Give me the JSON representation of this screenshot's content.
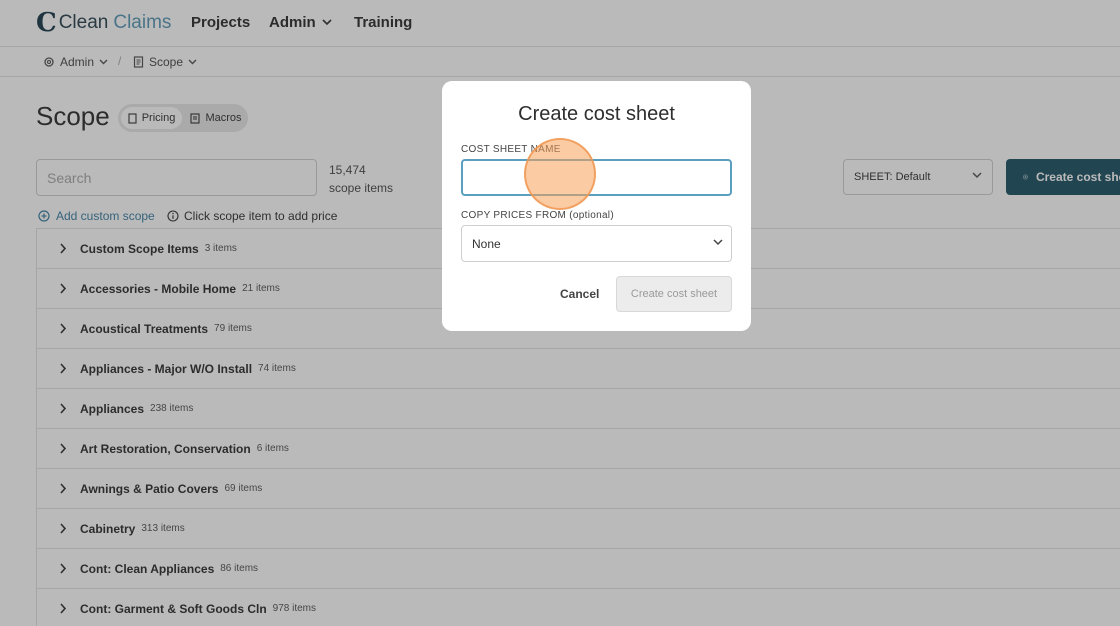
{
  "logo": {
    "mark": "C",
    "word1": "Clean",
    "word2": "Claims"
  },
  "nav": {
    "projects": "Projects",
    "admin": "Admin",
    "training": "Training"
  },
  "breadcrumb": {
    "admin": "Admin",
    "separator": "/",
    "scope": "Scope"
  },
  "page": {
    "title": "Scope",
    "toggle": {
      "pricing": "Pricing",
      "macros": "Macros"
    },
    "search_placeholder": "Search",
    "count_number": "15,474",
    "count_label": "scope items",
    "sheet_select": "SHEET: Default",
    "create_button": "Create cost sheet",
    "add_custom": "Add custom scope",
    "hint": "Click scope item to add price"
  },
  "categories": [
    {
      "name": "Custom Scope Items",
      "count": "3 items"
    },
    {
      "name": "Accessories - Mobile Home",
      "count": "21 items"
    },
    {
      "name": "Acoustical Treatments",
      "count": "79 items"
    },
    {
      "name": "Appliances - Major W/O Install",
      "count": "74 items"
    },
    {
      "name": "Appliances",
      "count": "238 items"
    },
    {
      "name": "Art Restoration, Conservation",
      "count": "6 items"
    },
    {
      "name": "Awnings & Patio Covers",
      "count": "69 items"
    },
    {
      "name": "Cabinetry",
      "count": "313 items"
    },
    {
      "name": "Cont: Clean Appliances",
      "count": "86 items"
    },
    {
      "name": "Cont: Garment & Soft Goods Cln",
      "count": "978 items"
    }
  ],
  "modal": {
    "title": "Create cost sheet",
    "name_label": "COST SHEET NAME",
    "name_value": "",
    "copy_label": "COPY PRICES FROM (optional)",
    "copy_value": "None",
    "cancel": "Cancel",
    "create": "Create cost sheet"
  },
  "colors": {
    "brand_dark": "#1e5466",
    "link": "#3d7fa3",
    "input_focus": "#5a9fc0"
  }
}
